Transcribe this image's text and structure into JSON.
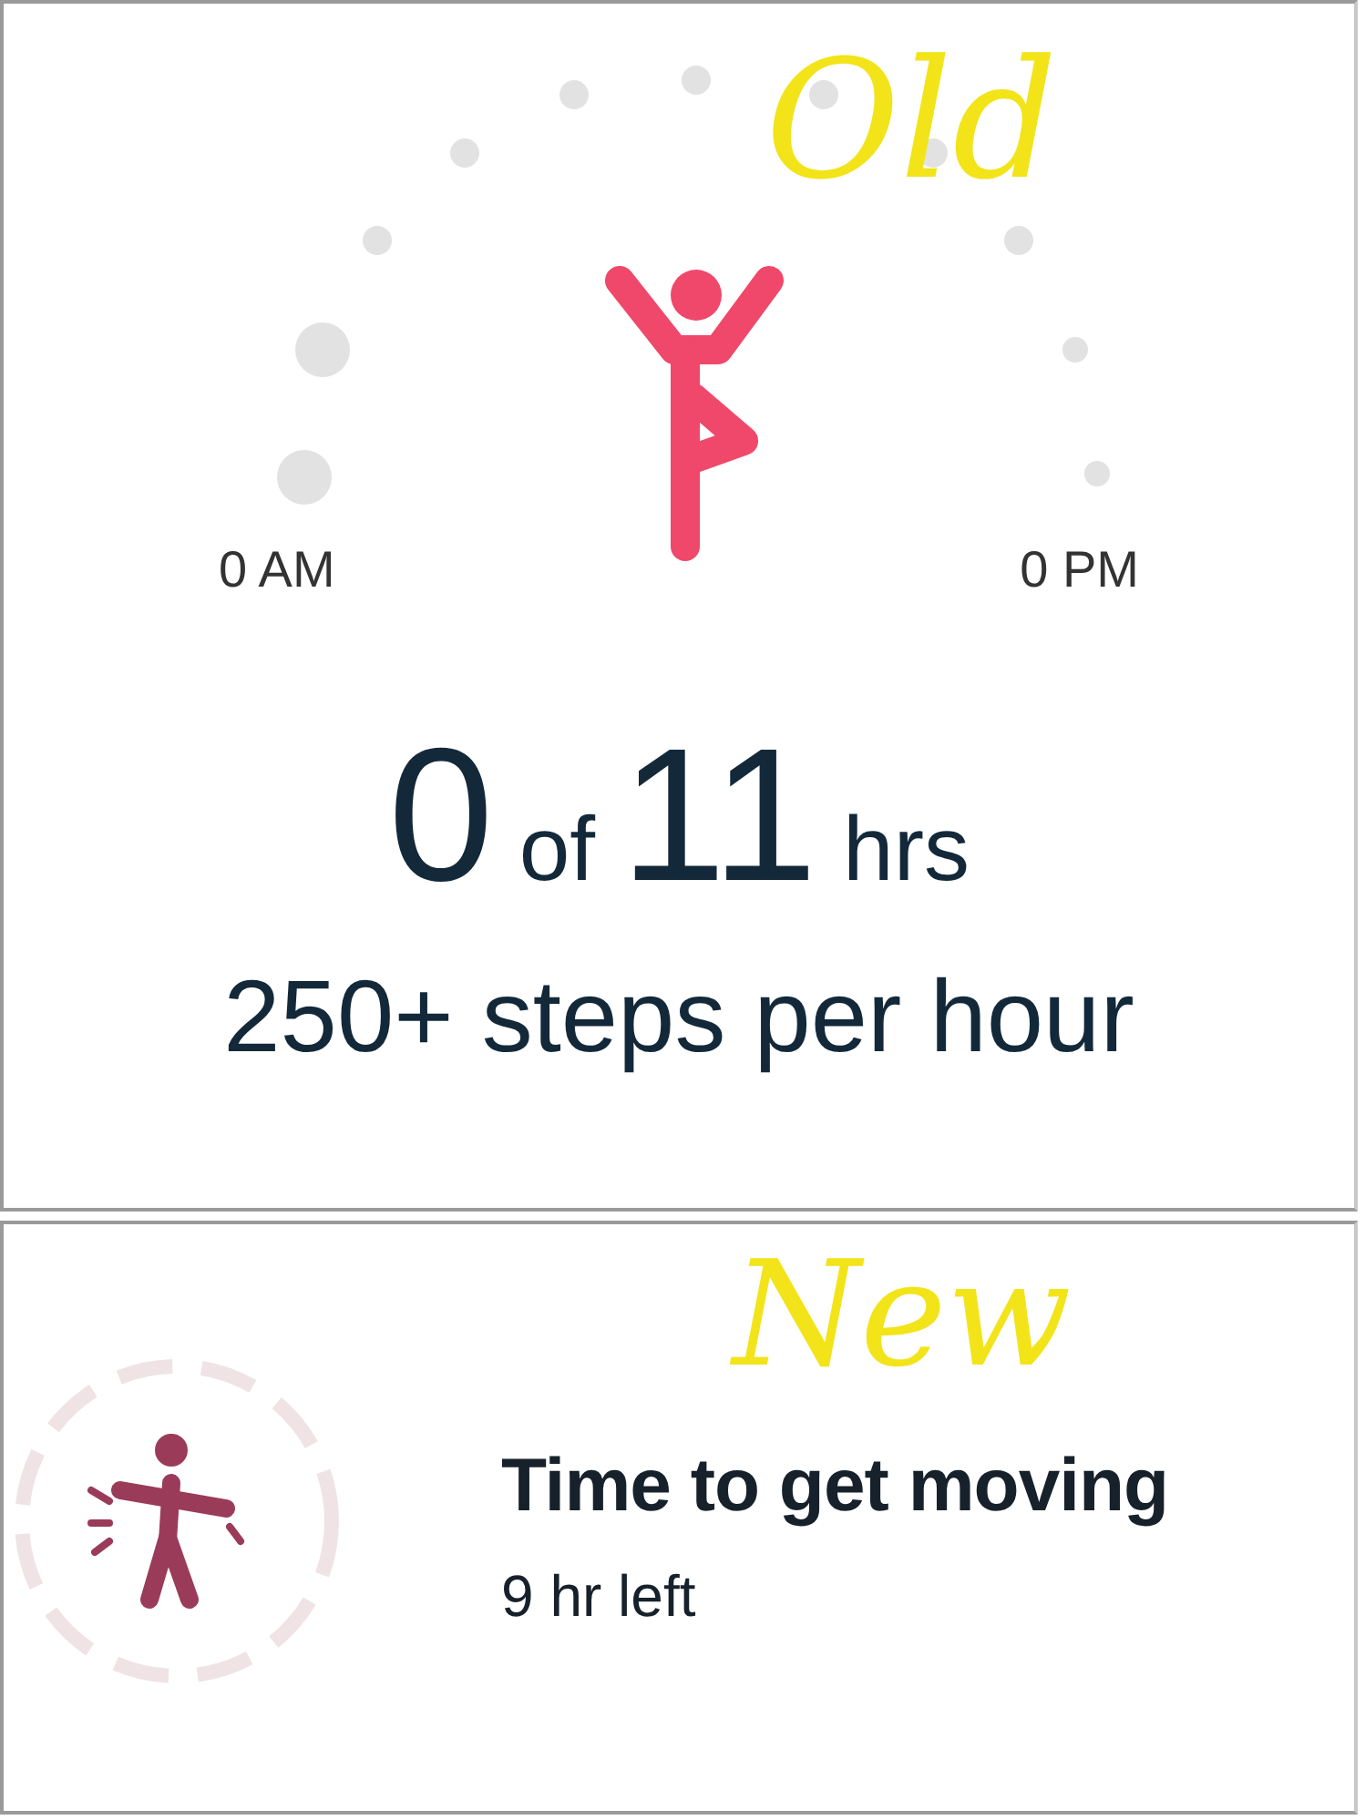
{
  "old_card": {
    "annotation": "Old",
    "start_label": "0 AM",
    "end_label": "0 PM",
    "progress": {
      "value": "0",
      "connector": "of",
      "goal": "11",
      "unit": "hrs"
    },
    "subtitle": "250+ steps per hour"
  },
  "new_card": {
    "annotation": "New",
    "title": "Time to get moving",
    "subtitle": "9 hr left"
  }
}
